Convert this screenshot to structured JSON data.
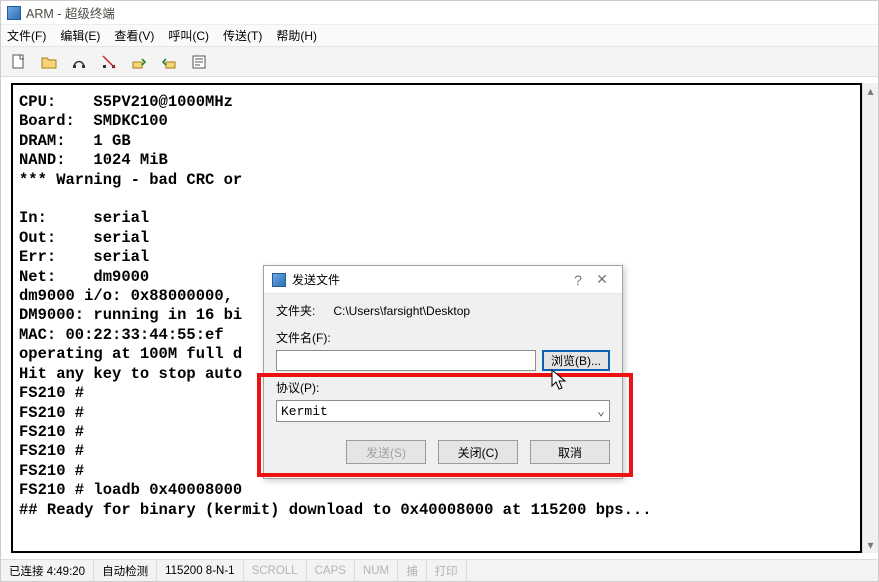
{
  "window": {
    "title": "ARM - 超级终端"
  },
  "menu": {
    "file": "文件(F)",
    "edit": "编辑(E)",
    "view": "查看(V)",
    "call": "呼叫(C)",
    "transfer": "传送(T)",
    "help": "帮助(H)"
  },
  "toolbar_icons": [
    "new-file-icon",
    "open-file-icon",
    "connect-icon",
    "disconnect-icon",
    "send-icon",
    "receive-icon",
    "properties-icon"
  ],
  "terminal_lines": [
    "CPU:    S5PV210@1000MHz",
    "Board:  SMDKC100",
    "DRAM:   1 GB",
    "NAND:   1024 MiB",
    "*** Warning - bad CRC or",
    "",
    "In:     serial",
    "Out:    serial",
    "Err:    serial",
    "Net:    dm9000",
    "dm9000 i/o: 0x88000000,",
    "DM9000: running in 16 bi",
    "MAC: 00:22:33:44:55:ef",
    "operating at 100M full d",
    "Hit any key to stop auto",
    "FS210 #",
    "FS210 #",
    "FS210 #",
    "FS210 #",
    "FS210 #",
    "FS210 # loadb 0x40008000",
    "## Ready for binary (kermit) download to 0x40008000 at 115200 bps..."
  ],
  "dialog": {
    "title": "发送文件",
    "folder_label": "文件夹:",
    "folder_value": "C:\\Users\\farsight\\Desktop",
    "filename_label": "文件名(F):",
    "filename_value": "",
    "browse_label": "浏览(B)...",
    "protocol_label": "协议(P):",
    "protocol_value": "Kermit",
    "send_label": "发送(S)",
    "close_label": "关闭(C)",
    "cancel_label": "取消"
  },
  "status": {
    "connected": "已连接 4:49:20",
    "autodetect": "自动检测",
    "port": "115200 8-N-1",
    "scroll": "SCROLL",
    "caps": "CAPS",
    "num": "NUM",
    "capture": "捕",
    "print": "打印"
  }
}
